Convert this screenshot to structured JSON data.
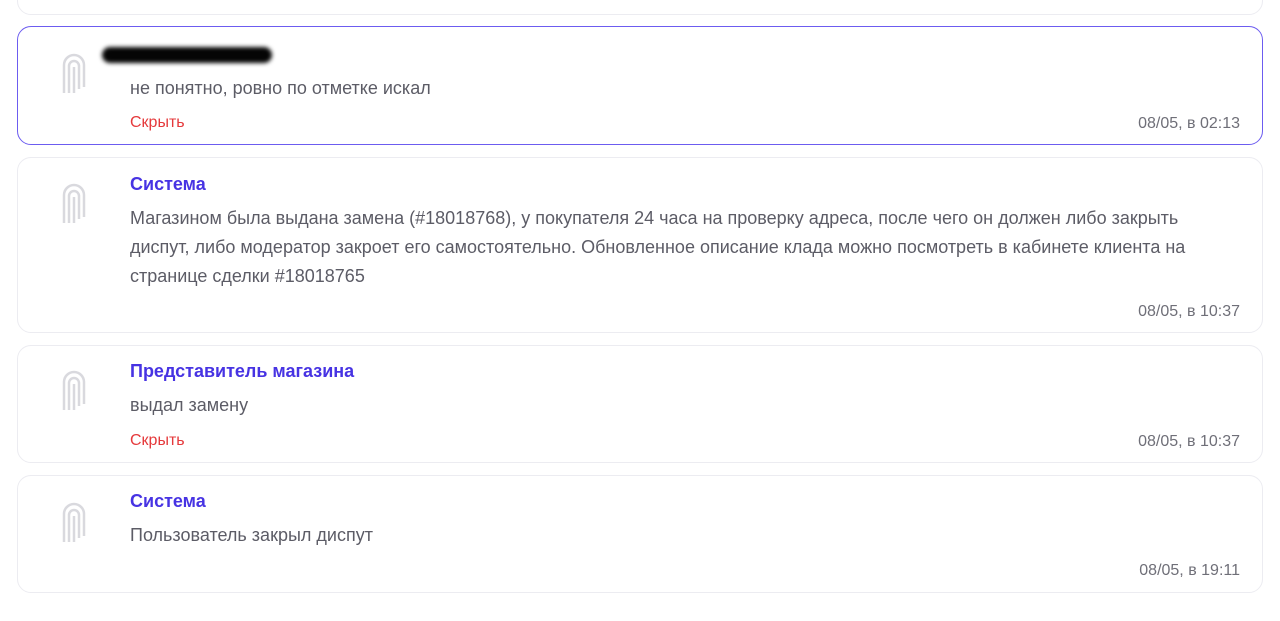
{
  "messages": [
    {
      "author": "",
      "text": "",
      "hide_label": "",
      "time": "08/05, в 02:.."
    },
    {
      "author": "",
      "text": "не понятно, ровно по отметке искал",
      "hide_label": "Скрыть",
      "time": "08/05, в 02:13"
    },
    {
      "author": "Система",
      "text": "Магазином была выдана замена (#18018768), у покупателя 24 часа на проверку адреса, после чего он должен либо закрыть диспут, либо модератор закроет его самостоятельно. Обновленное описание клада можно посмотреть в кабинете клиента на странице сделки #18018765",
      "time": "08/05, в 10:37"
    },
    {
      "author": "Представитель магазина",
      "text": "выдал замену",
      "hide_label": "Скрыть",
      "time": "08/05, в 10:37"
    },
    {
      "author": "Система",
      "text": "Пользователь закрыл диспут",
      "time": "08/05, в 19:11"
    }
  ],
  "colors": {
    "accent": "#4733e3",
    "highlight_border": "#6c5cf0",
    "hide": "#e5393b",
    "text": "#5c5c66",
    "time": "#6f6f78"
  },
  "icons": {
    "avatar": "bank-logo-icon"
  }
}
